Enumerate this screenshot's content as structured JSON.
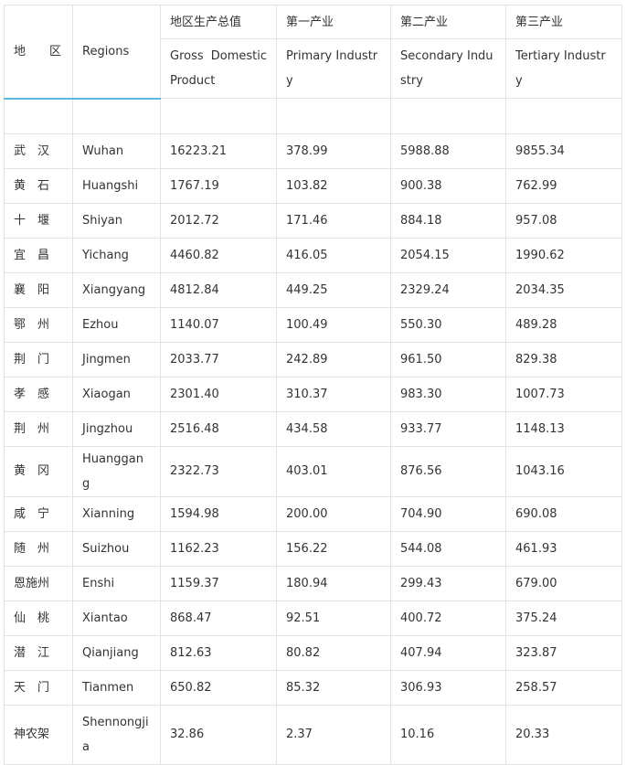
{
  "header": {
    "region_cn": "地　　区",
    "regions_en": "Regions",
    "gdp_cn": "地区生产总值",
    "gdp_en": "Gross Domestic Product",
    "primary_cn": "第一产业",
    "primary_en": "Primary Industry",
    "secondary_cn": "第二产业",
    "secondary_en": "Secondary Industry",
    "tertiary_cn": "第三产业",
    "tertiary_en": "Tertiary Industry"
  },
  "rows": [
    {
      "cn": "武　汉",
      "en": "Wuhan",
      "gdp": "16223.21",
      "primary": "378.99",
      "secondary": "5988.88",
      "tertiary": "9855.34"
    },
    {
      "cn": "黄　石",
      "en": "Huangshi",
      "gdp": "1767.19",
      "primary": "103.82",
      "secondary": "900.38",
      "tertiary": "762.99"
    },
    {
      "cn": "十　堰",
      "en": "Shiyan",
      "gdp": "2012.72",
      "primary": "171.46",
      "secondary": "884.18",
      "tertiary": "957.08"
    },
    {
      "cn": "宜　昌",
      "en": "Yichang",
      "gdp": "4460.82",
      "primary": "416.05",
      "secondary": "2054.15",
      "tertiary": "1990.62"
    },
    {
      "cn": "襄　阳",
      "en": "Xiangyang",
      "gdp": "4812.84",
      "primary": "449.25",
      "secondary": "2329.24",
      "tertiary": "2034.35"
    },
    {
      "cn": "鄂　州",
      "en": "Ezhou",
      "gdp": "1140.07",
      "primary": "100.49",
      "secondary": "550.30",
      "tertiary": "489.28"
    },
    {
      "cn": "荆　门",
      "en": "Jingmen",
      "gdp": "2033.77",
      "primary": "242.89",
      "secondary": "961.50",
      "tertiary": "829.38"
    },
    {
      "cn": "孝　感",
      "en": "Xiaogan",
      "gdp": "2301.40",
      "primary": "310.37",
      "secondary": "983.30",
      "tertiary": "1007.73"
    },
    {
      "cn": "荆　州",
      "en": "Jingzhou",
      "gdp": "2516.48",
      "primary": "434.58",
      "secondary": "933.77",
      "tertiary": "1148.13"
    },
    {
      "cn": "黄　冈",
      "en": "Huanggang",
      "gdp": "2322.73",
      "primary": "403.01",
      "secondary": "876.56",
      "tertiary": "1043.16"
    },
    {
      "cn": "咸　宁",
      "en": "Xianning",
      "gdp": "1594.98",
      "primary": "200.00",
      "secondary": "704.90",
      "tertiary": "690.08"
    },
    {
      "cn": "随　州",
      "en": "Suizhou",
      "gdp": "1162.23",
      "primary": "156.22",
      "secondary": "544.08",
      "tertiary": "461.93"
    },
    {
      "cn": "恩施州",
      "en": "Enshi",
      "gdp": "1159.37",
      "primary": "180.94",
      "secondary": "299.43",
      "tertiary": "679.00"
    },
    {
      "cn": "仙　桃",
      "en": "Xiantao",
      "gdp": "868.47",
      "primary": "92.51",
      "secondary": "400.72",
      "tertiary": "375.24"
    },
    {
      "cn": "潜　江",
      "en": "Qianjiang",
      "gdp": "812.63",
      "primary": "80.82",
      "secondary": "407.94",
      "tertiary": "323.87"
    },
    {
      "cn": "天　门",
      "en": "Tianmen",
      "gdp": "650.82",
      "primary": "85.32",
      "secondary": "306.93",
      "tertiary": "258.57"
    },
    {
      "cn": "神农架",
      "en": "Shennongjia",
      "gdp": "32.86",
      "primary": "2.37",
      "secondary": "10.16",
      "tertiary": "20.33"
    }
  ]
}
